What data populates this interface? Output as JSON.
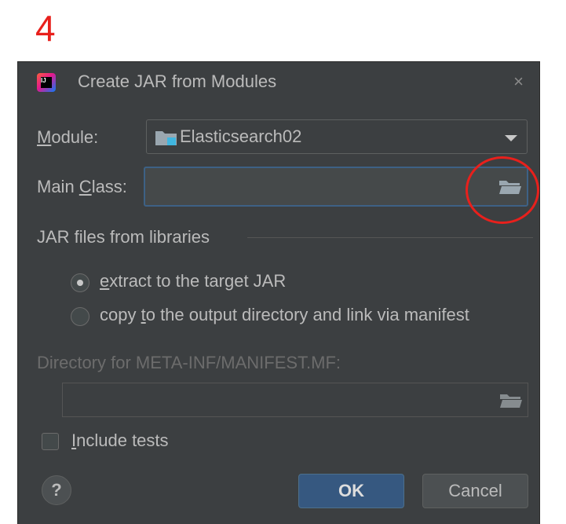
{
  "step_number": "4",
  "dialog": {
    "title": "Create JAR from Modules",
    "close_glyph": "×",
    "app_icon": "intellij-idea-icon",
    "app_icon_text": "IJ"
  },
  "module": {
    "label_mnemonic": "M",
    "label_rest": "odule:",
    "value": "Elasticsearch02",
    "icon": "module-folder-icon"
  },
  "main_class": {
    "label_before": "Main ",
    "label_mnemonic": "C",
    "label_after": "lass:",
    "value": "",
    "browse_icon": "folder-open-icon",
    "highlight_color": "#e8201c"
  },
  "libraries": {
    "section_title": "JAR files from libraries",
    "option_extract": {
      "mnemonic": "e",
      "rest": "xtract to the target JAR",
      "selected": true
    },
    "option_copy": {
      "before": "copy ",
      "mnemonic": "t",
      "after": "o the output directory and link via manifest",
      "selected": false
    }
  },
  "manifest": {
    "label": "Directory for META-INF/MANIFEST.MF:",
    "value": "",
    "browse_icon": "folder-open-icon",
    "enabled": false
  },
  "include_tests": {
    "mnemonic": "I",
    "rest": "nclude tests",
    "checked": false
  },
  "buttons": {
    "help": "?",
    "ok": "OK",
    "cancel": "Cancel"
  },
  "colors": {
    "dialog_bg": "#3c3f41",
    "text": "#bbbbbb",
    "focus_border": "#3d6185",
    "ok_bg": "#365880",
    "annotation_red": "#e8201c"
  }
}
